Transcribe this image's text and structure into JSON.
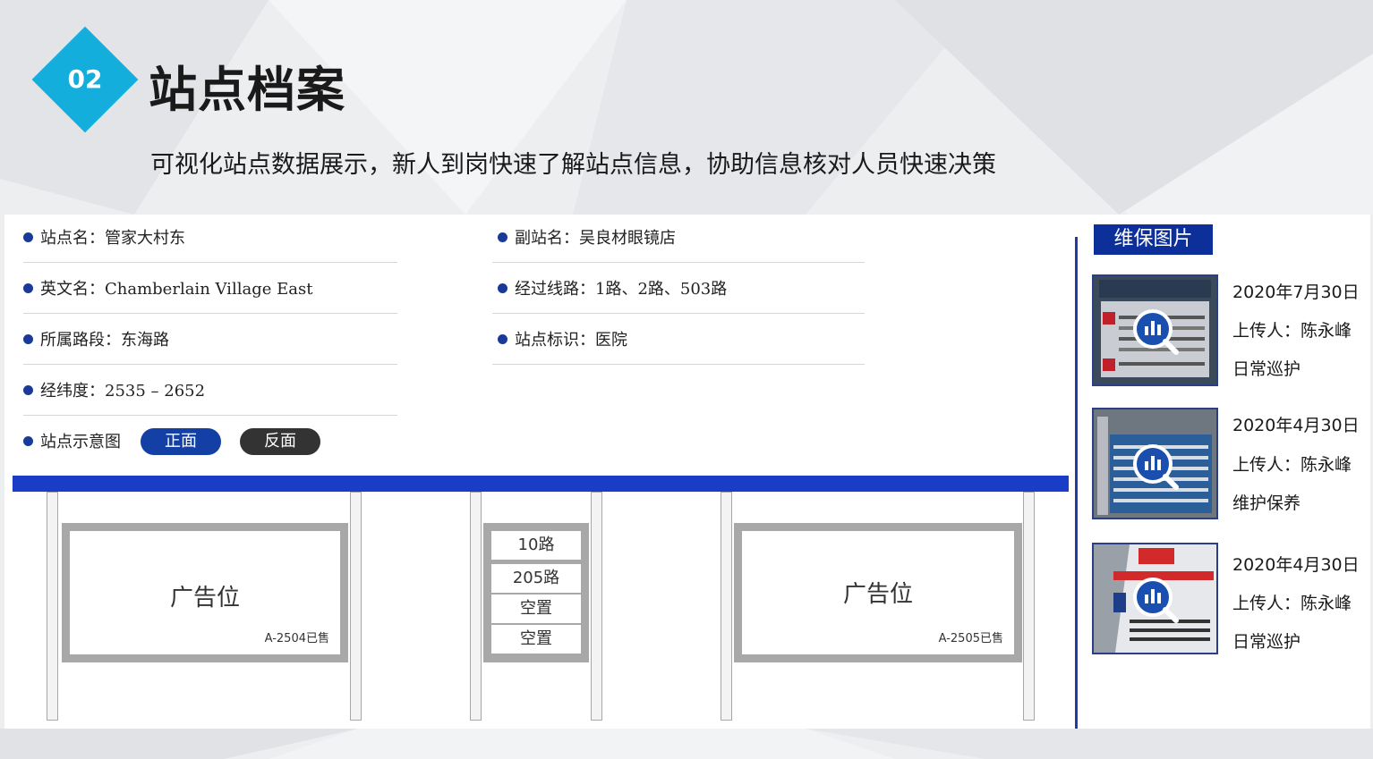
{
  "header": {
    "badge_number": "02",
    "title": "站点档案",
    "subtitle": "可视化站点数据展示，新人到岗快速了解站点信息，协助信息核对人员快速决策"
  },
  "station_info": {
    "name": "站点名：管家大村东",
    "alias": "副站名：吴良材眼镜店",
    "english_name": "英文名：Chamberlain Village East",
    "routes": "经过线路：1路、2路、503路",
    "road_segment": "所属路段：东海路",
    "landmark": "站点标识：医院",
    "coordinates": "经纬度：2535  –  2652",
    "diagram_label": "站点示意图",
    "front_button": "正面",
    "back_button": "反面"
  },
  "shelter": {
    "left_ad": {
      "label": "广告位",
      "code": "A-2504已售"
    },
    "right_ad": {
      "label": "广告位",
      "code": "A-2505已售"
    },
    "route_board": [
      "10路",
      "205路",
      "空置",
      "空置"
    ]
  },
  "maintenance": {
    "tab_label": "维保图片",
    "records": [
      {
        "date": "2020年7月30日",
        "uploader": "上传人：陈永峰",
        "type": "日常巡护"
      },
      {
        "date": "2020年4月30日",
        "uploader": "上传人：陈永峰",
        "type": "维护保养"
      },
      {
        "date": "2020年4月30日",
        "uploader": "上传人：陈永峰",
        "type": "日常巡护"
      }
    ]
  },
  "colors": {
    "accent_cyan": "#14aedd",
    "primary_blue": "#1a3dc8",
    "dark_blue": "#0d2f9a"
  }
}
